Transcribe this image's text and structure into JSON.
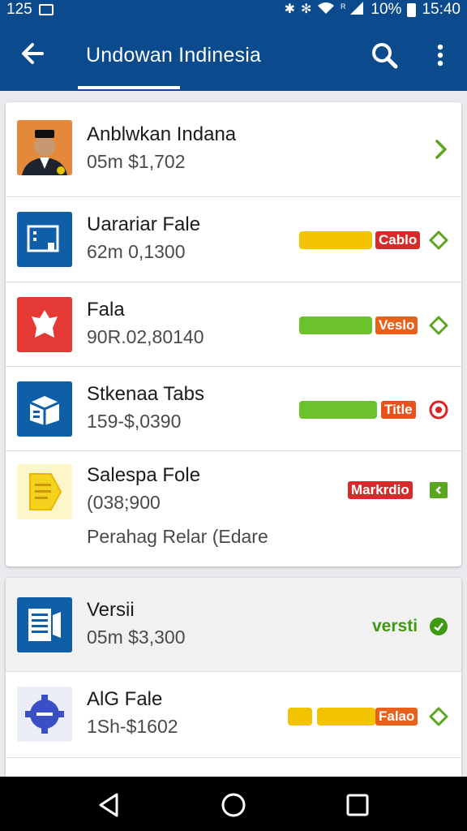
{
  "status_bar": {
    "time_left": "125",
    "battery": "10%",
    "clock": "15:40"
  },
  "app_bar": {
    "title": "Undowan Indinesia",
    "icons": [
      "back-arrow-icon",
      "search-icon",
      "more-vert-icon"
    ]
  },
  "list_primary": [
    {
      "name": "Anblwkan Indana",
      "meta": "05m $1,702",
      "thumb": "profile-photo",
      "action": "chevron-right-icon"
    },
    {
      "name": "Uarariar Fale",
      "meta": "62m 0,1300",
      "thumb": "document-app-icon",
      "progress": 0.62,
      "bar_color": "#f2c300",
      "badge": "Cablo",
      "badge_color": "#d62b2b",
      "action": "diamond-outline-icon"
    },
    {
      "name": "Fala",
      "meta": "90R.02,80140",
      "thumb": "red-app-icon",
      "progress": 0.62,
      "bar_color": "#6cc22a",
      "badge": "Veslo",
      "badge_color": "#e8611a",
      "action": "diamond-outline-icon"
    },
    {
      "name": "Stkenaa Tabs",
      "meta": "159-$,0390",
      "thumb": "box-app-icon",
      "progress": 0.7,
      "bar_color": "#6cc22a",
      "badge": "Title",
      "badge_color": "#e8521a",
      "action": "record-circle-icon"
    },
    {
      "name": "Salespa Fole",
      "meta": "(038;900",
      "extra": "Perahag Relar (Edare",
      "thumb": "yellow-doc-icon",
      "badge": "Markrdio",
      "badge_color": "#d62b2b",
      "action": "green-square-icon"
    }
  ],
  "list_secondary": [
    {
      "name": "Versii",
      "meta": "05m $3,300",
      "thumb": "list-app-icon",
      "status_label": "versti",
      "action": "check-circle-icon"
    },
    {
      "name": "AlG Fale",
      "meta": "1Sh-$1602",
      "thumb": "gear-app-icon",
      "progress": 0.5,
      "bar_color": "#f2c300",
      "badge": "Falao",
      "badge_color": "#e8611a",
      "action": "diamond-outline-icon"
    }
  ]
}
